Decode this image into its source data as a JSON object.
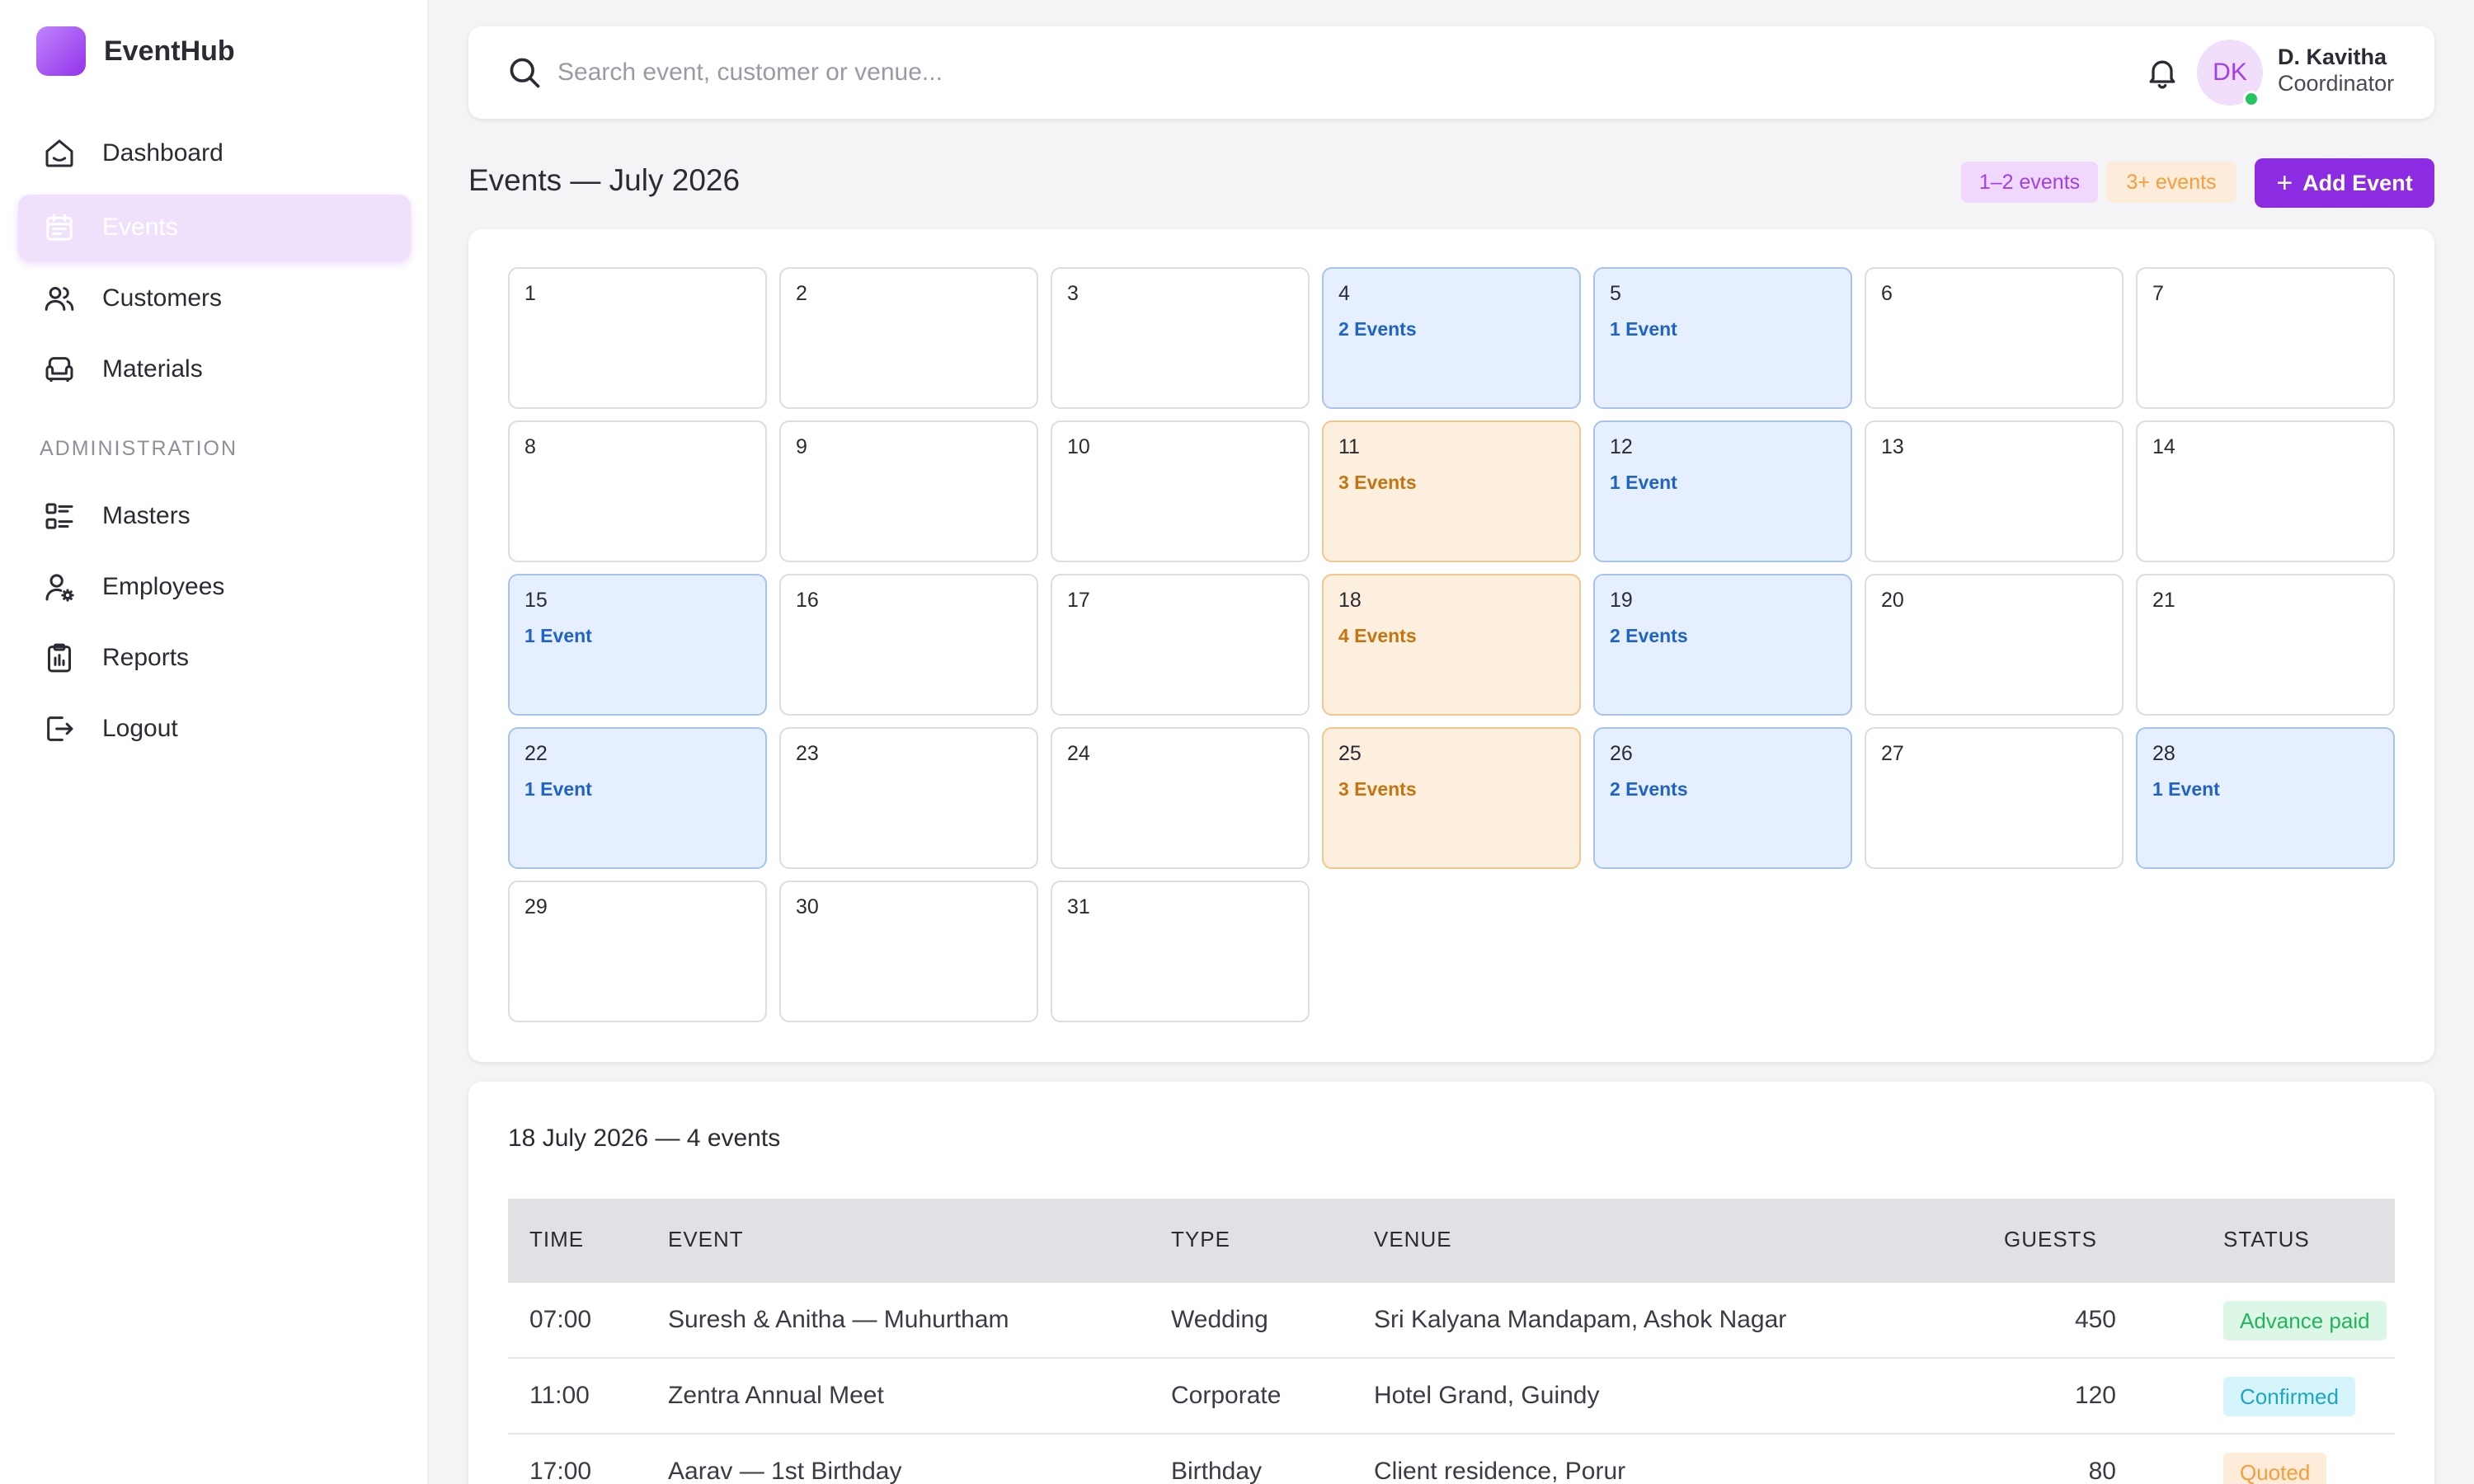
{
  "app": {
    "name": "EventHub"
  },
  "sidebar": {
    "items": [
      {
        "label": "Dashboard",
        "icon": "home-icon"
      },
      {
        "label": "Events",
        "icon": "calendar-icon",
        "active": true
      },
      {
        "label": "Customers",
        "icon": "users-icon"
      },
      {
        "label": "Materials",
        "icon": "armchair-icon"
      }
    ],
    "section_label": "ADMINISTRATION",
    "admin_items": [
      {
        "label": "Masters",
        "icon": "list-icon"
      },
      {
        "label": "Employees",
        "icon": "user-cog-icon"
      },
      {
        "label": "Reports",
        "icon": "clipboard-icon"
      },
      {
        "label": "Logout",
        "icon": "logout-icon"
      }
    ]
  },
  "topbar": {
    "search_placeholder": "Search event, customer or venue...",
    "user": {
      "initials": "DK",
      "name": "D. Kavitha",
      "role": "Coordinator",
      "online": true
    }
  },
  "header": {
    "title": "Events — July 2026",
    "legend": [
      {
        "label": "1–2 events",
        "color": "#a23ef0"
      },
      {
        "label": "3+ events",
        "color": "#f59e3b"
      }
    ],
    "add_label": "Add Event"
  },
  "calendar": {
    "days": [
      {
        "day": "1",
        "events": "",
        "level": "none"
      },
      {
        "day": "2",
        "events": "",
        "level": "none"
      },
      {
        "day": "3",
        "events": "",
        "level": "none"
      },
      {
        "day": "4",
        "events": "2 Events",
        "level": "low"
      },
      {
        "day": "5",
        "events": "1 Event",
        "level": "low"
      },
      {
        "day": "6",
        "events": "",
        "level": "none"
      },
      {
        "day": "7",
        "events": "",
        "level": "none"
      },
      {
        "day": "8",
        "events": "",
        "level": "none"
      },
      {
        "day": "9",
        "events": "",
        "level": "none"
      },
      {
        "day": "10",
        "events": "",
        "level": "none"
      },
      {
        "day": "11",
        "events": "3 Events",
        "level": "high"
      },
      {
        "day": "12",
        "events": "1 Event",
        "level": "low"
      },
      {
        "day": "13",
        "events": "",
        "level": "none"
      },
      {
        "day": "14",
        "events": "",
        "level": "none"
      },
      {
        "day": "15",
        "events": "1 Event",
        "level": "low"
      },
      {
        "day": "16",
        "events": "",
        "level": "none"
      },
      {
        "day": "17",
        "events": "",
        "level": "none"
      },
      {
        "day": "18",
        "events": "4 Events",
        "level": "high"
      },
      {
        "day": "19",
        "events": "2 Events",
        "level": "low"
      },
      {
        "day": "20",
        "events": "",
        "level": "none"
      },
      {
        "day": "21",
        "events": "",
        "level": "none"
      },
      {
        "day": "22",
        "events": "1 Event",
        "level": "low"
      },
      {
        "day": "23",
        "events": "",
        "level": "none"
      },
      {
        "day": "24",
        "events": "",
        "level": "none"
      },
      {
        "day": "25",
        "events": "3 Events",
        "level": "high"
      },
      {
        "day": "26",
        "events": "2 Events",
        "level": "low"
      },
      {
        "day": "27",
        "events": "",
        "level": "none"
      },
      {
        "day": "28",
        "events": "1 Event",
        "level": "low"
      },
      {
        "day": "29",
        "events": "",
        "level": "none"
      },
      {
        "day": "30",
        "events": "",
        "level": "none"
      },
      {
        "day": "31",
        "events": "",
        "level": "none"
      }
    ]
  },
  "detail": {
    "title": "18 July 2026 — 4 events",
    "columns": [
      "TIME",
      "EVENT",
      "TYPE",
      "VENUE",
      "GUESTS",
      "STATUS"
    ],
    "rows": [
      {
        "time": "07:00",
        "event": "Suresh & Anitha — Muhurtham",
        "type": "Wedding",
        "venue": "Sri Kalyana Mandapam, Ashok Nagar",
        "guests": "450",
        "status": "Advance paid",
        "status_color": "green"
      },
      {
        "time": "11:00",
        "event": "Zentra Annual Meet",
        "type": "Corporate",
        "venue": "Hotel Grand, Guindy",
        "guests": "120",
        "status": "Confirmed",
        "status_color": "cyan"
      },
      {
        "time": "17:00",
        "event": "Aarav — 1st Birthday",
        "type": "Birthday",
        "venue": "Client residence, Porur",
        "guests": "80",
        "status": "Quoted",
        "status_color": "orange"
      }
    ]
  }
}
